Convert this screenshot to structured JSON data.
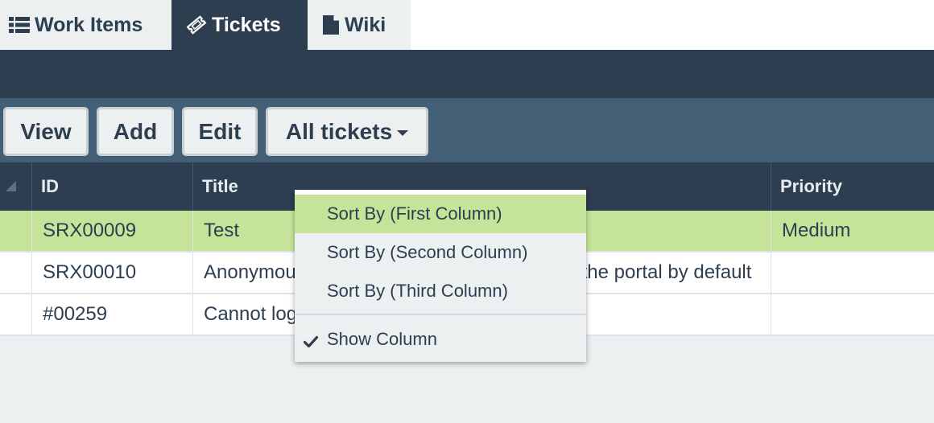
{
  "tabs": [
    {
      "label": "Work Items",
      "icon": "list-icon",
      "active": false
    },
    {
      "label": "Tickets",
      "icon": "ticket-icon",
      "active": true
    },
    {
      "label": "Wiki",
      "icon": "document-icon",
      "active": false
    }
  ],
  "toolbar": {
    "view_label": "View",
    "add_label": "Add",
    "edit_label": "Edit",
    "filter_label": "All tickets"
  },
  "table": {
    "columns": [
      "ID",
      "Title",
      "Priority"
    ],
    "rows": [
      {
        "id": "SRX00009",
        "title": "Test",
        "priority": "Medium",
        "selected": true
      },
      {
        "id": "SRX00010",
        "title": "Anonymous users should be able to access the portal by default",
        "priority": "",
        "selected": false
      },
      {
        "id": "#00259",
        "title": "Cannot login",
        "priority": "",
        "selected": false
      }
    ]
  },
  "context_menu": {
    "items": [
      {
        "label": "Sort By (First Column)",
        "highlighted": true
      },
      {
        "label": "Sort By (Second Column)",
        "highlighted": false
      },
      {
        "label": "Sort By (Third Column)",
        "highlighted": false
      },
      {
        "label": "Show Column",
        "checked": true
      }
    ]
  },
  "colors": {
    "dark_navy": "#2c3e50",
    "toolbar_slate": "#425f75",
    "selection_green": "#c5e49a",
    "background": "#ecf0f1"
  }
}
